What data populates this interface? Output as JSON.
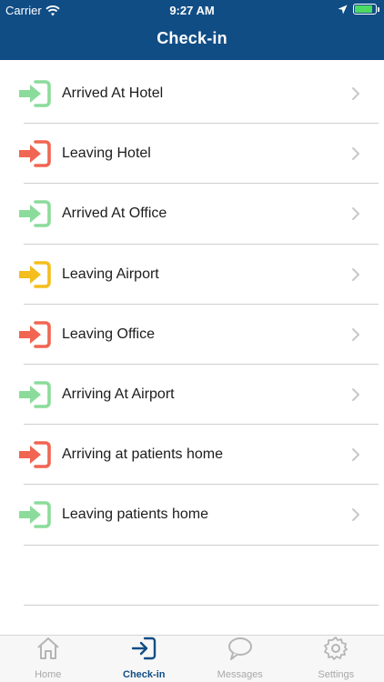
{
  "status": {
    "carrier": "Carrier",
    "time": "9:27 AM"
  },
  "header": {
    "title": "Check-in"
  },
  "colors": {
    "header": "#114d85",
    "green": "#8bdc9b",
    "red": "#f06652",
    "yellow": "#f4be1c"
  },
  "items": [
    {
      "label": "Arrived At Hotel",
      "icon": "login-arrow-icon",
      "color": "#8bdc9b"
    },
    {
      "label": "Leaving Hotel",
      "icon": "login-arrow-icon",
      "color": "#f06652"
    },
    {
      "label": "Arrived At Office",
      "icon": "login-arrow-icon",
      "color": "#8bdc9b"
    },
    {
      "label": "Leaving Airport",
      "icon": "login-arrow-icon",
      "color": "#f4be1c"
    },
    {
      "label": "Leaving Office",
      "icon": "login-arrow-icon",
      "color": "#f06652"
    },
    {
      "label": "Arriving At Airport",
      "icon": "login-arrow-icon",
      "color": "#8bdc9b"
    },
    {
      "label": "Arriving at patients home",
      "icon": "login-arrow-icon",
      "color": "#f06652"
    },
    {
      "label": "Leaving patients home",
      "icon": "login-arrow-icon",
      "color": "#8bdc9b"
    }
  ],
  "tabs": [
    {
      "label": "Home",
      "icon": "home-icon",
      "active": false
    },
    {
      "label": "Check-in",
      "icon": "checkin-icon",
      "active": true
    },
    {
      "label": "Messages",
      "icon": "chat-bubble-icon",
      "active": false
    },
    {
      "label": "Settings",
      "icon": "gear-icon",
      "active": false
    }
  ]
}
